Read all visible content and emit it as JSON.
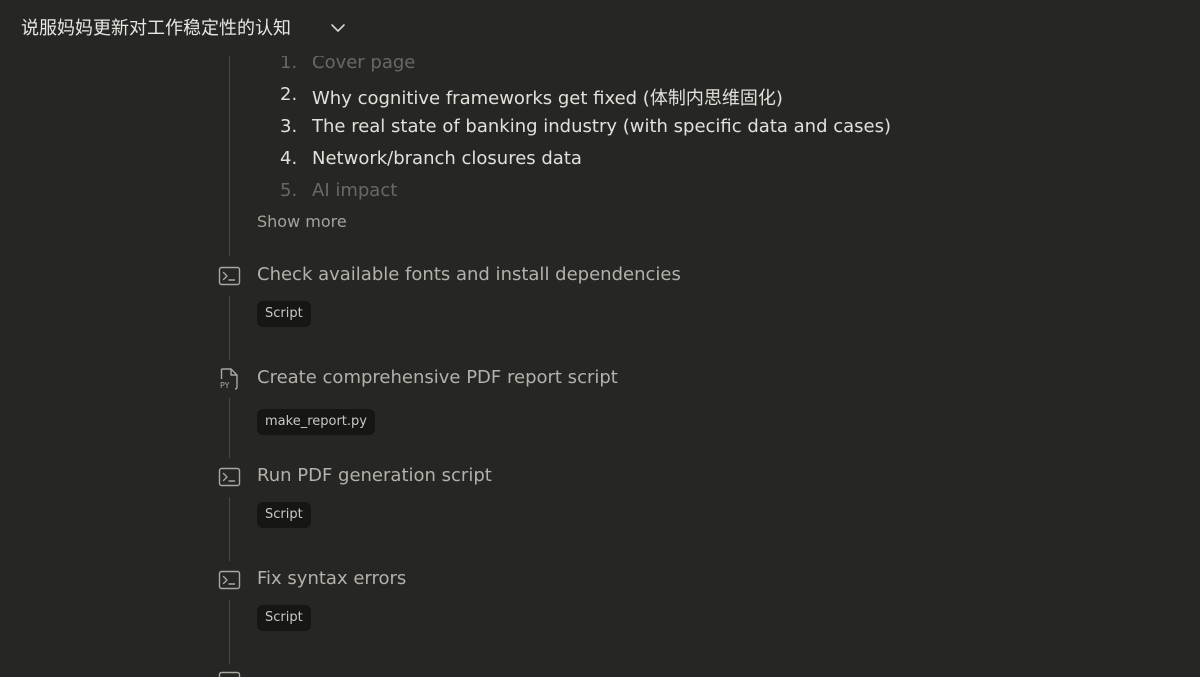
{
  "header": {
    "title": "说服妈妈更新对工作稳定性的认知",
    "chevron_icon": "chevron-down-icon"
  },
  "plan": {
    "items": [
      {
        "num": "1.",
        "text": "Cover page"
      },
      {
        "num": "2.",
        "text": "Why cognitive frameworks get fixed (体制内思维固化)"
      },
      {
        "num": "3.",
        "text": "The real state of banking industry (with specific data and cases)"
      },
      {
        "num": "4.",
        "text": "Network/branch closures data"
      },
      {
        "num": "5.",
        "text": "AI impact"
      }
    ],
    "show_more": "Show more"
  },
  "steps": [
    {
      "icon": "terminal-icon",
      "title": "Check available fonts and install dependencies",
      "chip": "Script"
    },
    {
      "icon": "python-file-icon",
      "title": "Create comprehensive PDF report script",
      "chip": "make_report.py"
    },
    {
      "icon": "terminal-icon",
      "title": "Run PDF generation script",
      "chip": "Script"
    },
    {
      "icon": "terminal-icon",
      "title": "Fix syntax errors",
      "chip": "Script"
    }
  ],
  "colors": {
    "background": "#262624",
    "chip_background": "#161615",
    "timeline": "#4a4945"
  }
}
